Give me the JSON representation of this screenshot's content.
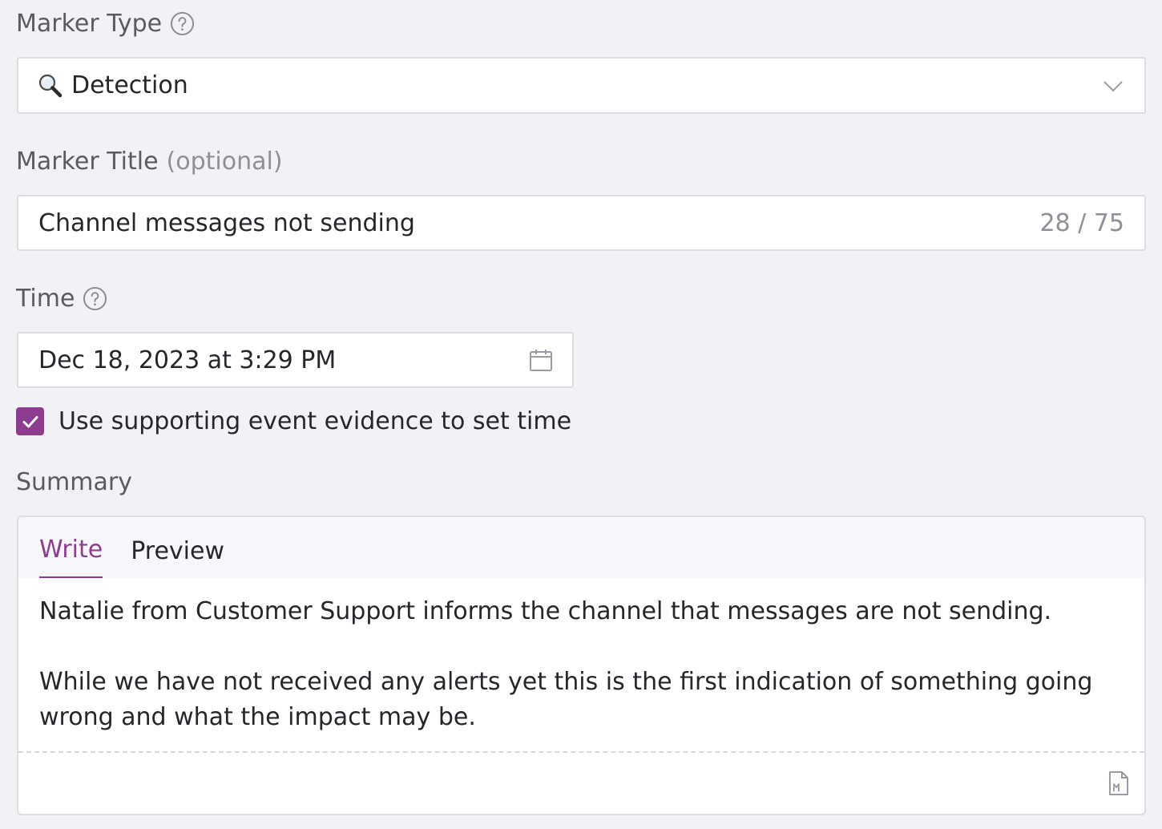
{
  "marker_type": {
    "label": "Marker Type",
    "selected_value": "Detection",
    "icon": "magnifying-glass-icon"
  },
  "marker_title": {
    "label": "Marker Title",
    "optional_label": "(optional)",
    "value": "Channel messages not sending",
    "counter": "28 / 75"
  },
  "time": {
    "label": "Time",
    "value": "Dec 18, 2023 at 3:29 PM"
  },
  "evidence_checkbox": {
    "label": "Use supporting event evidence to set time",
    "checked": true
  },
  "summary": {
    "label": "Summary",
    "tabs": [
      {
        "label": "Write",
        "active": true
      },
      {
        "label": "Preview",
        "active": false
      }
    ],
    "paragraph_1": "Natalie from Customer Support informs the channel that messages are not sending.",
    "paragraph_2": "While we have not received any alerts yet this is the first indication of something going wrong and what the impact may be."
  },
  "colors": {
    "accent": "#8c3d8e",
    "background": "#f1f2f6",
    "border": "#dcdde2"
  }
}
